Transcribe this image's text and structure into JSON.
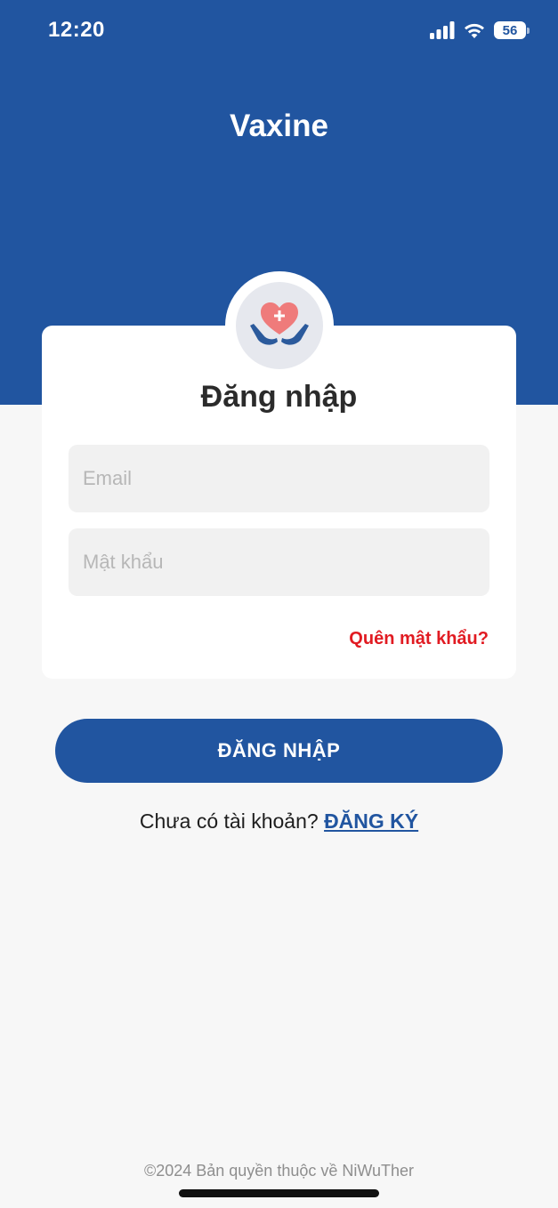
{
  "status_bar": {
    "time": "12:20",
    "battery": "56",
    "icons": [
      "signal-icon",
      "wifi-icon",
      "battery-icon"
    ]
  },
  "app": {
    "title": "Vaxine",
    "logo_icon": "heart-hands-icon"
  },
  "login": {
    "title": "Đăng nhập",
    "email_placeholder": "Email",
    "email_value": "",
    "password_placeholder": "Mật khẩu",
    "password_value": "",
    "forgot_label": "Quên mật khẩu?",
    "submit_label": "ĐĂNG NHẬP"
  },
  "signup": {
    "prompt": "Chưa có tài khoản?",
    "link_label": "ĐĂNG KÝ"
  },
  "footer": {
    "copyright": "©2024 Bản quyền thuộc về NiWuTher"
  },
  "colors": {
    "primary": "#2155a0",
    "danger": "#e11b22",
    "background": "#f7f7f7",
    "heart": "#ef7b7b"
  }
}
